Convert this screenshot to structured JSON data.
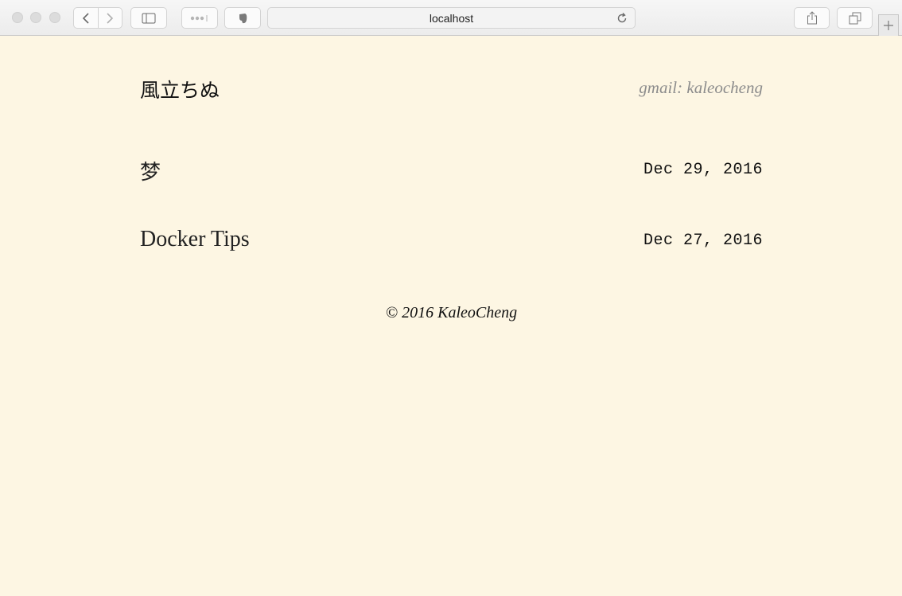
{
  "browser": {
    "address": "localhost"
  },
  "header": {
    "site_title": "風立ちぬ",
    "contact": "gmail: kaleocheng"
  },
  "posts": [
    {
      "title": "梦",
      "date": "Dec 29, 2016"
    },
    {
      "title": "Docker Tips",
      "date": "Dec 27, 2016"
    }
  ],
  "footer": {
    "copyright": "© 2016 KaleoCheng"
  },
  "colors": {
    "background": "#fdf6e3",
    "muted_text": "#8c8c8c"
  }
}
